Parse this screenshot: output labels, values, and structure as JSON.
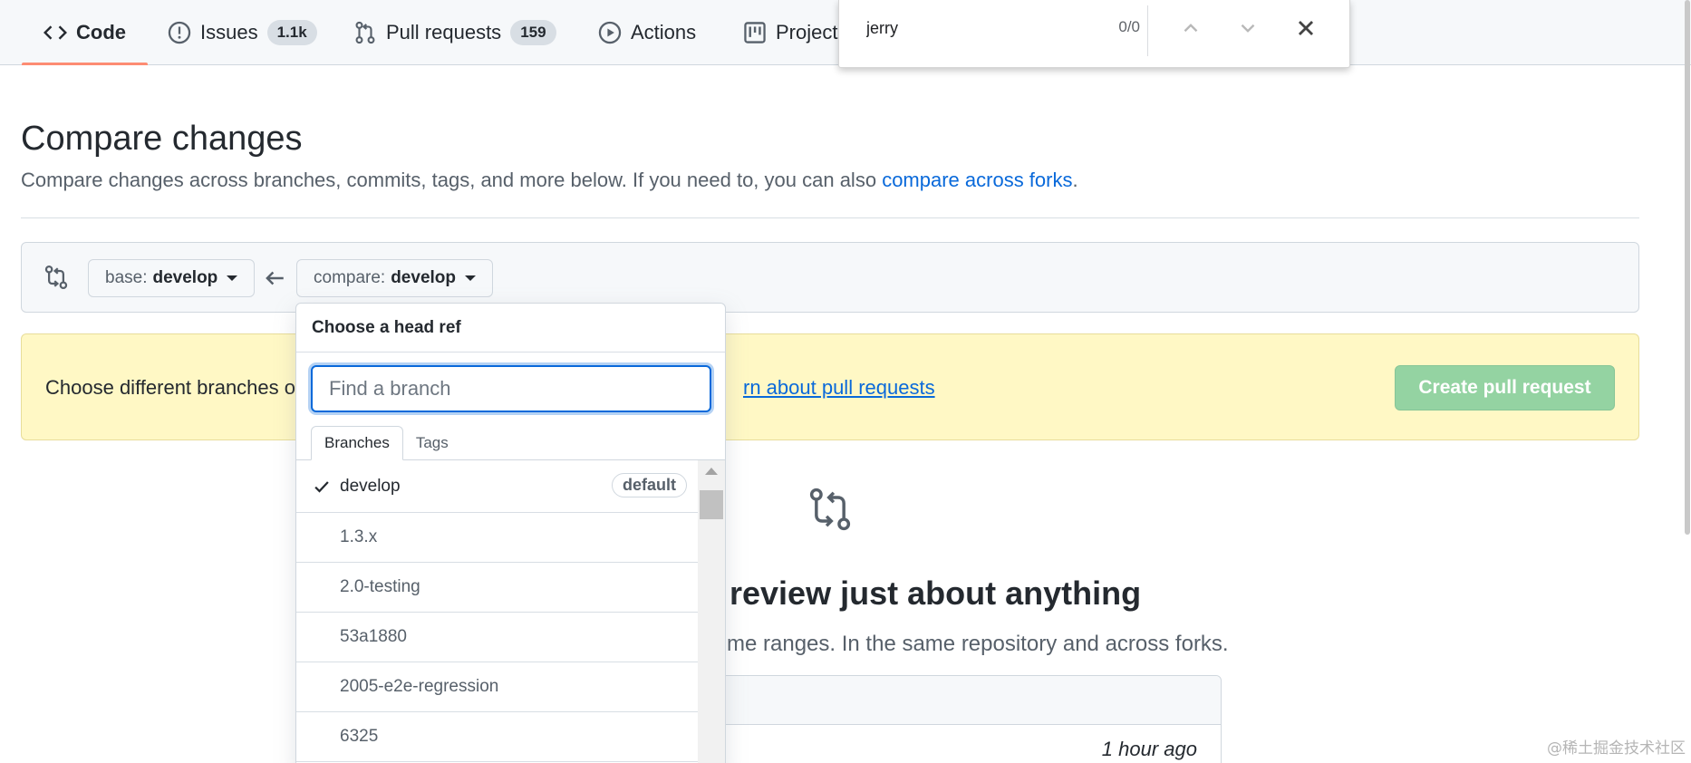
{
  "nav": {
    "code": "Code",
    "issues": "Issues",
    "issues_count": "1.1k",
    "pull_requests": "Pull requests",
    "pull_requests_count": "159",
    "actions": "Actions",
    "projects": "Project"
  },
  "find_bar": {
    "query": "jerry",
    "count": "0/0"
  },
  "header": {
    "title": "Compare changes",
    "description": "Compare changes across branches, commits, tags, and more below. If you need to, you can also",
    "description_link": "compare across forks",
    "description_end": "."
  },
  "range": {
    "base_label": "base:",
    "base_value": "develop",
    "compare_label": "compare:",
    "compare_value": "develop"
  },
  "flash": {
    "text": "Choose different branches o",
    "link": "rn about pull requests",
    "create_button": "Create pull request"
  },
  "blankslate": {
    "heading": "review just about anything",
    "subtext": "d time ranges. In the same repository and across forks.",
    "time": "1 hour ago"
  },
  "dropdown": {
    "title": "Choose a head ref",
    "filter_placeholder": "Find a branch",
    "tabs": [
      "Branches",
      "Tags"
    ],
    "default_badge": "default",
    "branches": [
      "develop",
      "1.3.x",
      "2.0-testing",
      "53a1880",
      "2005-e2e-regression",
      "6325"
    ]
  },
  "watermark": "@稀土掘金技术社区",
  "colors": {
    "accent_blue": "#0969da",
    "underline": "#fd8c73",
    "flash_bg": "#fff8c5",
    "create_button_bg": "#94d3a2"
  }
}
